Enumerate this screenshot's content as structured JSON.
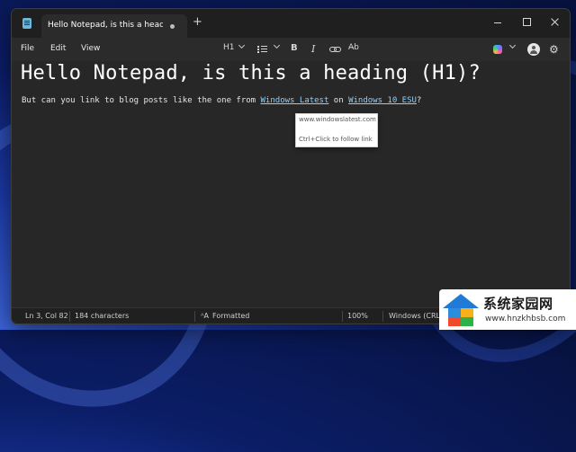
{
  "window": {
    "tab_title": "Hello Notepad, is this a heading (H",
    "new_tab_symbol": "+"
  },
  "menu": {
    "file": "File",
    "edit": "Edit",
    "view": "View"
  },
  "toolbar": {
    "heading_style": "H1",
    "bold": "B",
    "italic": "I",
    "clear_format": "A̶b"
  },
  "document": {
    "heading": "Hello Notepad, is this a heading (H1)?",
    "para_before": "But can you link to blog posts like the one from ",
    "link1": "Windows Latest",
    "para_middle": " on ",
    "link2": "Windows 10 ESU",
    "para_after": "?"
  },
  "tooltip": {
    "url": "www.windowslatest.com",
    "hint": "Ctrl+Click to follow link"
  },
  "status": {
    "position": "Ln 3, Col 82",
    "characters": "184 characters",
    "format_icon": "ᴬA",
    "format": "Formatted",
    "zoom": "100%",
    "line_ending": "Windows (CRL"
  },
  "watermark": {
    "site_name": "系统家园网",
    "site_url": "www.hnzkhbsb.com"
  },
  "colors": {
    "link": "#8fd0ff",
    "editor_bg": "#272727",
    "titlebar_bg": "#1f1f1f"
  }
}
